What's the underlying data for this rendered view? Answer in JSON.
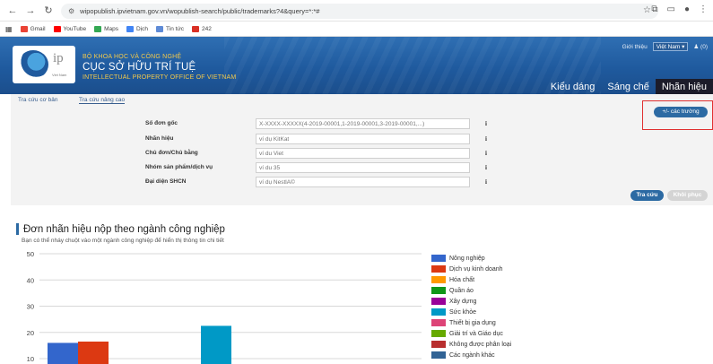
{
  "browser": {
    "url": "wipopublish.ipvietnam.gov.vn/wopublish-search/public/trademarks?4&query=*:*#",
    "bookmarks": [
      "Gmail",
      "YouTube",
      "Maps",
      "Dịch",
      "Tin tức",
      "242"
    ]
  },
  "header": {
    "logo_text": "ip",
    "logo_sub": "Viet Nam",
    "ministry": "BỘ KHOA HỌC VÀ CÔNG NGHỆ",
    "office_vi": "CỤC SỞ HỮU TRÍ TUỆ",
    "office_en": "INTELLECTUAL PROPERTY OFFICE OF VIETNAM",
    "intro_link": "Giới thiệu",
    "language": "Việt Nam",
    "user_label": "(0)",
    "tabs": [
      {
        "label": "Kiểu dáng",
        "active": false
      },
      {
        "label": "Sáng chế",
        "active": false
      },
      {
        "label": "Nhãn hiệu",
        "active": true
      }
    ]
  },
  "search": {
    "tabs": [
      "Tra cứu cơ bản",
      "Tra cứu nâng cao"
    ],
    "fields": [
      {
        "label": "Số đơn gốc",
        "placeholder": "X-XXXX-XXXXX(4-2019-00001,1-2019-00001,3-2019-00001,...)"
      },
      {
        "label": "Nhãn hiệu",
        "placeholder": "ví dụ KitKat"
      },
      {
        "label": "Chủ đơn/Chủ bằng",
        "placeholder": "ví du Viet"
      },
      {
        "label": "Nhóm sản phẩm/dịch vụ",
        "placeholder": "ví du 35"
      },
      {
        "label": "Đại diện SHCN",
        "placeholder": "ví dụ NestlÃ©"
      }
    ],
    "info_glyph": "i",
    "more_fields_label": "+/- các trường",
    "search_label": "Tra cứu",
    "reset_label": "Khôi phục"
  },
  "chart_section": {
    "title": "Đơn nhãn hiệu nộp theo ngành công nghiệp",
    "subtitle": "Bạn có thể nháy chuột vào một ngành công nghiệp để hiển thị thông tin chi tiết"
  },
  "chart_data": {
    "type": "bar",
    "ylim": [
      0,
      50
    ],
    "yticks": [
      10,
      20,
      30,
      40,
      50
    ],
    "visible_range": [
      8,
      50
    ],
    "grid": true,
    "legend_position": "right",
    "series": [
      {
        "name": "Nông nghiệp",
        "color": "#3366cc",
        "value": 16
      },
      {
        "name": "Dịch vụ kinh doanh",
        "color": "#dc3912",
        "value": 16.5
      },
      {
        "name": "Hóa chất",
        "color": "#ff9900",
        "value": null
      },
      {
        "name": "Quần áo",
        "color": "#109618",
        "value": null
      },
      {
        "name": "Xây dựng",
        "color": "#990099",
        "value": null
      },
      {
        "name": "Sức khỏe",
        "color": "#0099c6",
        "value": 22.5
      },
      {
        "name": "Thiết bị gia dụng",
        "color": "#dd4477",
        "value": null
      },
      {
        "name": "Giải trí và Giáo dục",
        "color": "#66aa00",
        "value": null
      },
      {
        "name": "Không được phân loại",
        "color": "#b82e2e",
        "value": null
      },
      {
        "name": "Các ngành khác",
        "color": "#316395",
        "value": null
      }
    ]
  }
}
